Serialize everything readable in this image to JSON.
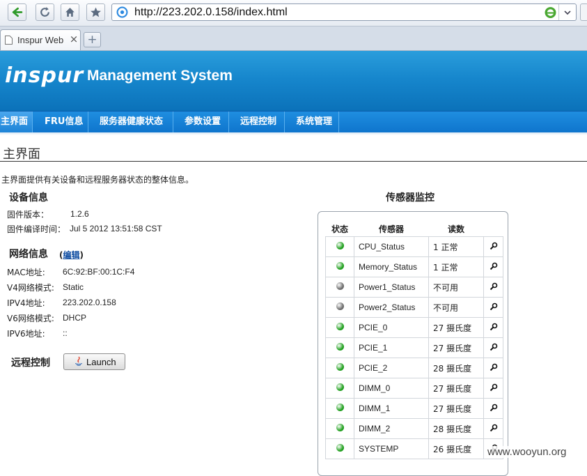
{
  "browser": {
    "url": "http://223.202.0.158/index.html",
    "tab_title": "Inspur Web",
    "tab_close": "×",
    "new_tab": "+"
  },
  "header": {
    "logo": "inspur",
    "system_name": "Management System"
  },
  "nav": {
    "items": [
      {
        "label": "主界面"
      },
      {
        "label": "FRU信息"
      },
      {
        "label": "服务器健康状态"
      },
      {
        "label": "参数设置"
      },
      {
        "label": "远程控制"
      },
      {
        "label": "系统管理"
      }
    ]
  },
  "page": {
    "title": "主界面",
    "description": "主界面提供有关设备和远程服务器状态的整体信息。"
  },
  "device_info": {
    "heading": "设备信息",
    "firmware_version_label": "固件版本：",
    "firmware_version": "1.2.6",
    "build_time_label": "固件编译时间：",
    "build_time": "Jul 5 2012 13:51:58 CST"
  },
  "network_info": {
    "heading": "网络信息",
    "edit_open": "(",
    "edit_label": "编辑",
    "edit_close": ")",
    "mac_label": "MAC地址:",
    "mac": "6C:92:BF:00:1C:F4",
    "v4_mode_label": "V4网络模式:",
    "v4_mode": "Static",
    "ipv4_label": "IPV4地址:",
    "ipv4": "223.202.0.158",
    "v6_mode_label": "V6网络模式:",
    "v6_mode": "DHCP",
    "ipv6_label": "IPV6地址:",
    "ipv6": "::"
  },
  "remote_control": {
    "heading": "远程控制",
    "launch_label": "Launch"
  },
  "sensors": {
    "heading": "传感器监控",
    "columns": [
      "状态",
      "传感器",
      "读数"
    ],
    "status_colors": {
      "ok": "#22a020",
      "na": "#6e6e6e"
    },
    "rows": [
      {
        "status": "ok",
        "name": "CPU_Status",
        "reading": "1 正常"
      },
      {
        "status": "ok",
        "name": "Memory_Status",
        "reading": "1 正常"
      },
      {
        "status": "na",
        "name": "Power1_Status",
        "reading": "不可用"
      },
      {
        "status": "na",
        "name": "Power2_Status",
        "reading": "不可用"
      },
      {
        "status": "ok",
        "name": "PCIE_0",
        "reading": "27 摄氏度"
      },
      {
        "status": "ok",
        "name": "PCIE_1",
        "reading": "27 摄氏度"
      },
      {
        "status": "ok",
        "name": "PCIE_2",
        "reading": "28 摄氏度"
      },
      {
        "status": "ok",
        "name": "DIMM_0",
        "reading": "27 摄氏度"
      },
      {
        "status": "ok",
        "name": "DIMM_1",
        "reading": "27 摄氏度"
      },
      {
        "status": "ok",
        "name": "DIMM_2",
        "reading": "28 摄氏度"
      },
      {
        "status": "ok",
        "name": "SYSTEMP",
        "reading": "26 摄氏度"
      }
    ]
  },
  "watermark": "www.wooyun.org"
}
